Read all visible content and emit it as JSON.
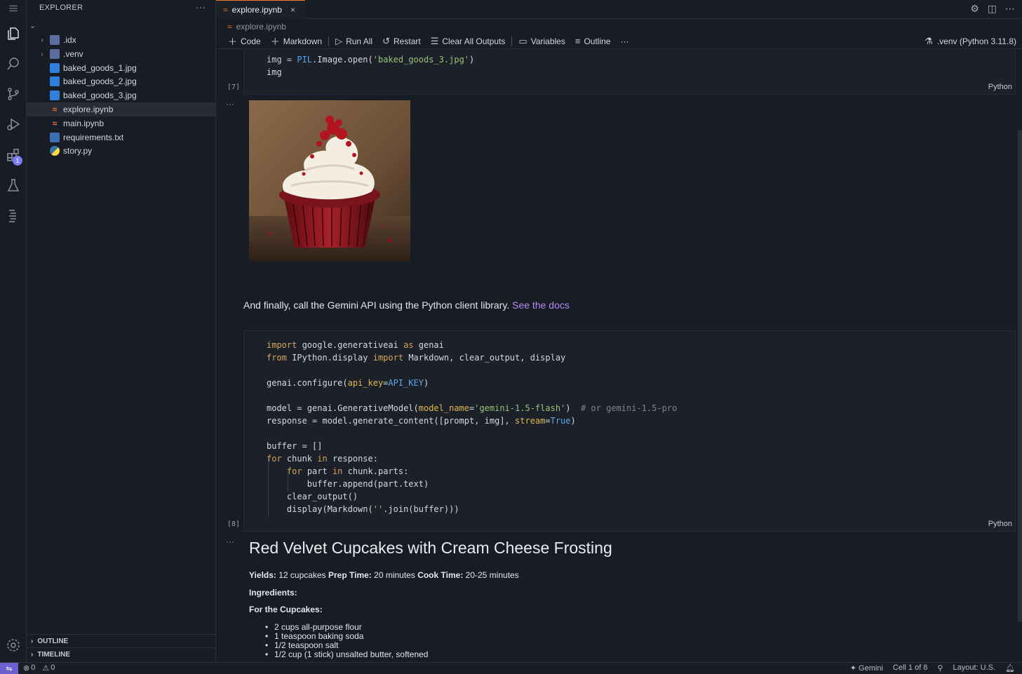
{
  "sidebar": {
    "title": "EXPLORER",
    "more": "···",
    "items": [
      {
        "label": ".idx",
        "type": "folder"
      },
      {
        "label": ".venv",
        "type": "folder"
      },
      {
        "label": "baked_goods_1.jpg",
        "type": "image"
      },
      {
        "label": "baked_goods_2.jpg",
        "type": "image"
      },
      {
        "label": "baked_goods_3.jpg",
        "type": "image"
      },
      {
        "label": "explore.ipynb",
        "type": "notebook",
        "selected": true
      },
      {
        "label": "main.ipynb",
        "type": "notebook"
      },
      {
        "label": "requirements.txt",
        "type": "text"
      },
      {
        "label": "story.py",
        "type": "python"
      }
    ],
    "outline": "OUTLINE",
    "timeline": "TIMELINE"
  },
  "activity": {
    "extensions_badge": "1"
  },
  "tab": {
    "label": "explore.ipynb",
    "close": "×"
  },
  "breadcrumb": {
    "file": "explore.ipynb"
  },
  "toolbar": {
    "code": "Code",
    "markdown": "Markdown",
    "run_all": "Run All",
    "restart": "Restart",
    "clear_all_outputs": "Clear All Outputs",
    "variables": "Variables",
    "outline": "Outline",
    "more": "···",
    "kernel": ".venv (Python 3.11.8)"
  },
  "cells": {
    "cell7": {
      "count": "[7]",
      "lang": "Python"
    },
    "cell8": {
      "count": "[8]",
      "lang": "Python"
    },
    "md_text": "And finally, call the Gemini API using the Python client library.",
    "md_link": "See the docs",
    "out_ellipsis": "···"
  },
  "output": {
    "title": "Red Velvet Cupcakes with Cream Cheese Frosting",
    "yields_label": "Yields:",
    "yields": "12 cupcakes",
    "prep_label": "Prep Time:",
    "prep": "20 minutes",
    "cook_label": "Cook Time:",
    "cook": "20-25 minutes",
    "ingredients": "Ingredients:",
    "for_cupcakes": "For the Cupcakes:",
    "list": [
      "2 cups all-purpose flour",
      "1 teaspoon baking soda",
      "1/2 teaspoon salt",
      "1/2 cup (1 stick) unsalted butter, softened"
    ]
  },
  "status": {
    "errors": "0",
    "warnings": "0",
    "gemini": "Gemini",
    "cell": "Cell 1 of 8",
    "layout": "Layout: U.S."
  }
}
